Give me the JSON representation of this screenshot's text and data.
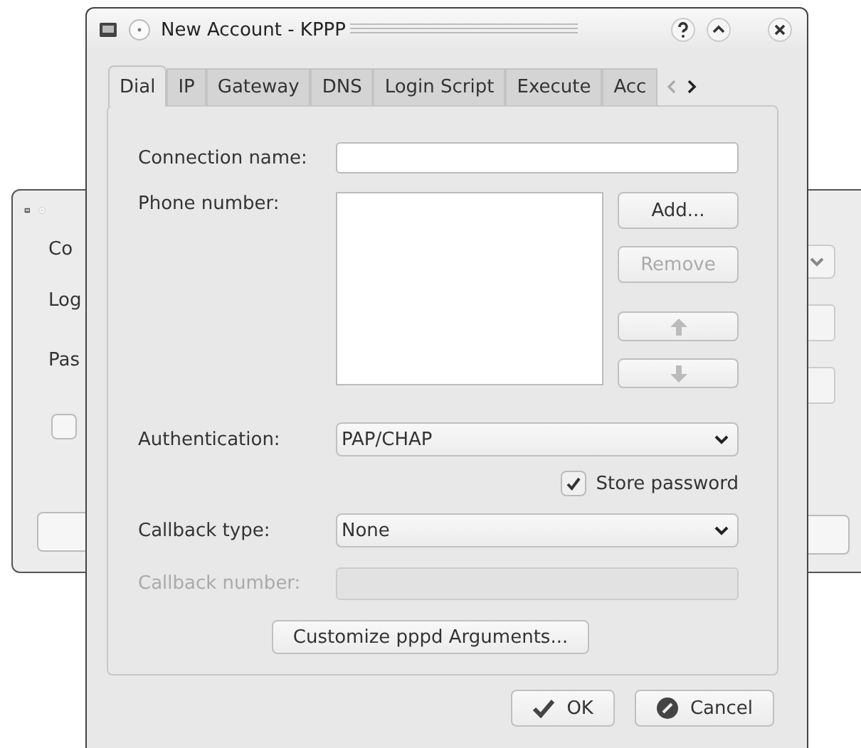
{
  "background_window": {
    "labels": [
      "Co",
      "Log",
      "Pas"
    ],
    "checkbox": {
      "checked": false
    }
  },
  "window": {
    "title": "New Account - KPPP"
  },
  "tabs": [
    {
      "label": "Dial",
      "selected": true
    },
    {
      "label": "IP",
      "selected": false
    },
    {
      "label": "Gateway",
      "selected": false
    },
    {
      "label": "DNS",
      "selected": false
    },
    {
      "label": "Login Script",
      "selected": false
    },
    {
      "label": "Execute",
      "selected": false
    },
    {
      "label": "Acc",
      "selected": false
    }
  ],
  "connection_name": {
    "label": "Connection name:"
  },
  "phone_number": {
    "label": "Phone number:"
  },
  "phone_buttons": [
    {
      "label": "Add...",
      "disabled": false
    },
    {
      "label": "Remove",
      "disabled": true
    }
  ],
  "authentication": {
    "label": "Authentication:",
    "value": "PAP/CHAP"
  },
  "store_password": {
    "label": "Store password",
    "checked": true
  },
  "callback_type": {
    "label": "Callback type:",
    "value": "None"
  },
  "callback_number": {
    "label": "Callback number:",
    "disabled": true
  },
  "customize_button": "Customize pppd Arguments...",
  "buttons": [
    {
      "kind": "ok",
      "label": "OK"
    },
    {
      "kind": "cancel",
      "label": "Cancel"
    }
  ]
}
